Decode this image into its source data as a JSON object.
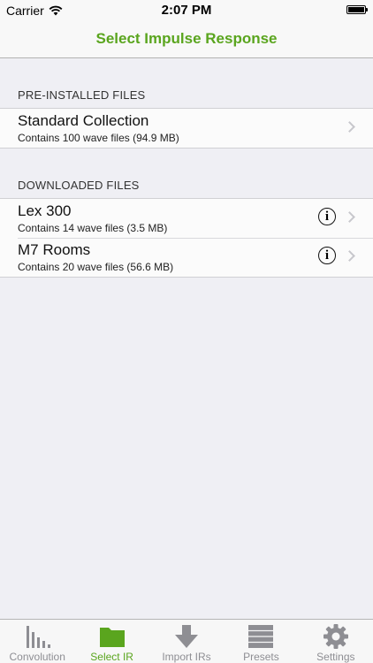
{
  "status_bar": {
    "carrier": "Carrier",
    "time": "2:07 PM"
  },
  "nav": {
    "title": "Select Impulse Response"
  },
  "sections": [
    {
      "header": "PRE-INSTALLED FILES",
      "rows": [
        {
          "title": "Standard Collection",
          "subtitle": "Contains 100 wave files (94.9 MB)"
        }
      ]
    },
    {
      "header": "DOWNLOADED FILES",
      "rows": [
        {
          "title": "Lex 300",
          "subtitle": "Contains 14 wave files (3.5 MB)"
        },
        {
          "title": "M7 Rooms",
          "subtitle": "Contains 20 wave files (56.6 MB)"
        }
      ]
    }
  ],
  "tabs": [
    {
      "label": "Convolution",
      "icon": "bar-chart-icon"
    },
    {
      "label": "Select IR",
      "icon": "folder-icon"
    },
    {
      "label": "Import IRs",
      "icon": "download-arrow-icon"
    },
    {
      "label": "Presets",
      "icon": "list-icon"
    },
    {
      "label": "Settings",
      "icon": "gear-icon"
    }
  ],
  "colors": {
    "accent": "#5aa51e",
    "inactive": "#8e8e93",
    "background": "#efeff4"
  }
}
